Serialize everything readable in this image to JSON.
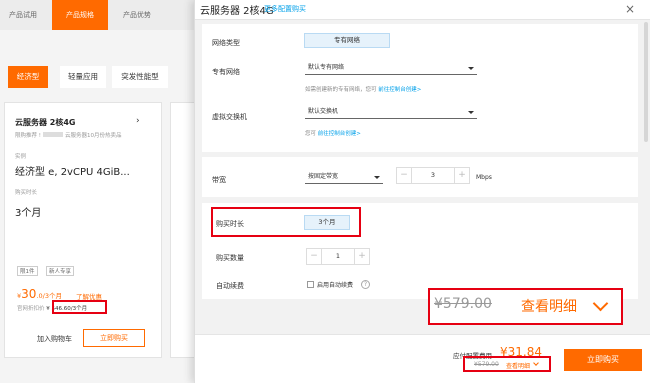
{
  "left_page": {
    "top_tabs": [
      "产品试用",
      "产品规格",
      "产品优势"
    ],
    "sub_tabs": [
      "经济型",
      "轻量应用",
      "突发性能型"
    ],
    "card": {
      "title": "云服务器 2核4G",
      "recommend": "限购推荐 !",
      "recommend_tail": "云服务器10月份热卖品",
      "instance_label": "实例",
      "instance_value": "经济型 e, 2vCPU 4GiB...",
      "duration_label": "购买时长",
      "duration_value": "3个月",
      "chips": [
        "限1件",
        "新人专享"
      ],
      "price_symbol": "¥",
      "price": "30",
      "price_decimal": ".0",
      "price_unit": "/3个月",
      "promo_link": "了解优惠",
      "orig_label": "官网折扣价",
      "orig_price": "¥ 546.60/3个月",
      "add_cart": "加入购物车",
      "buy_now": "立即购买"
    }
  },
  "panel": {
    "title": "云服务器 2核4G",
    "title_link": "更多配置购买",
    "close_glyph": "×",
    "network": {
      "type_label": "网络类型",
      "type_value": "专有网络",
      "vpc_label": "专有网络",
      "vpc_value": "默认专有网络",
      "vpc_help_prefix": "如需创建新的专有网络，您可",
      "vpc_help_link": "前往控制台创建>",
      "vswitch_label": "虚拟交换机",
      "vswitch_value": "默认交换机",
      "vswitch_help_prefix": "您可",
      "vswitch_help_link": "前往控制台创建>"
    },
    "bandwidth": {
      "label": "带宽",
      "mode": "按固定带宽",
      "value": "3",
      "unit": "Mbps"
    },
    "purchase": {
      "duration_label": "购买时长",
      "duration_value": "3个月",
      "quantity_label": "购买数量",
      "quantity_value": "1",
      "auto_renew_label": "自动续费",
      "auto_renew_option": "启用自动续费",
      "help_glyph": "?"
    },
    "zoom_overlay": {
      "orig_price": "¥579.00",
      "detail_link": "查看明细"
    },
    "footer": {
      "fee_label": "应付配置费用",
      "price": "¥31.84",
      "orig_price": "¥579.00",
      "detail_link": "查看明细",
      "buy_now": "立即购买"
    }
  },
  "colors": {
    "brand_orange": "#ff6a00",
    "link_blue": "#00a0e9",
    "highlight_red": "#e60012"
  }
}
